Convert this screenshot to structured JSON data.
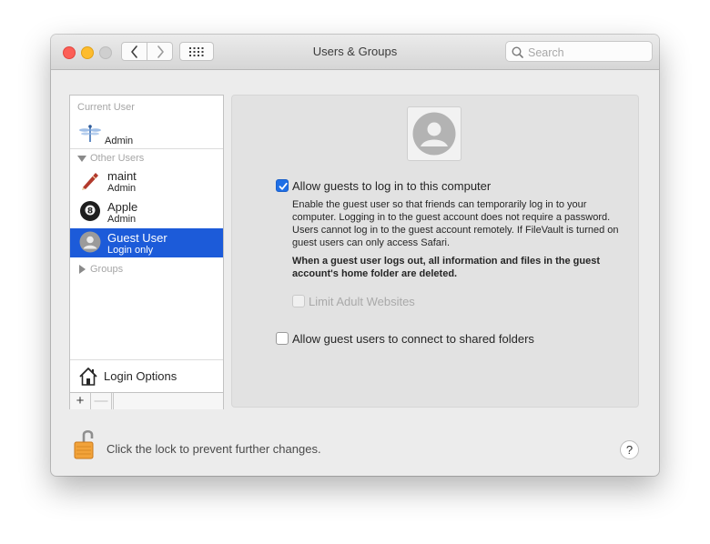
{
  "window": {
    "title": "Users & Groups"
  },
  "toolbar": {
    "back_icon": "chevron-left-icon",
    "forward_icon": "chevron-right-icon",
    "show_all_icon": "grid-icon"
  },
  "search": {
    "placeholder": "Search",
    "value": ""
  },
  "sidebar": {
    "current_user_label": "Current User",
    "current_user": {
      "name": "",
      "role": "Admin",
      "avatar_icon": "dragonfly-icon"
    },
    "other_users_label": "Other Users",
    "other_users": [
      {
        "name": "maint",
        "role": "Admin",
        "avatar_icon": "pen-icon",
        "selected": false
      },
      {
        "name": "Apple",
        "role": "Admin",
        "avatar_icon": "eightball-icon",
        "selected": false
      },
      {
        "name": "Guest User",
        "role": "Login only",
        "avatar_icon": "person-icon",
        "selected": true
      }
    ],
    "groups_label": "Groups",
    "login_options_label": "Login Options",
    "add_label": "+",
    "remove_label": "—"
  },
  "panel": {
    "allow_guests": {
      "label": "Allow guests to log in to this computer",
      "checked": true
    },
    "description": "Enable the guest user so that friends can temporarily log in to your computer. Logging in to the guest account does not require a password. Users cannot log in to the guest account remotely. If FileVault is turned on guest users can only access Safari.",
    "warning": "When a guest user logs out, all information and files in the guest account's home folder are deleted.",
    "limit_adult": {
      "label": "Limit Adult Websites",
      "checked": false,
      "enabled": false
    },
    "shared_folders": {
      "label": "Allow guest users to connect to shared folders",
      "checked": false
    }
  },
  "footer": {
    "lock_text": "Click the lock to prevent further changes.",
    "help_label": "?"
  },
  "colors": {
    "selection": "#1c5bd9",
    "checkbox_on": "#1f6fe6",
    "lock_body": "#f2a33a"
  }
}
